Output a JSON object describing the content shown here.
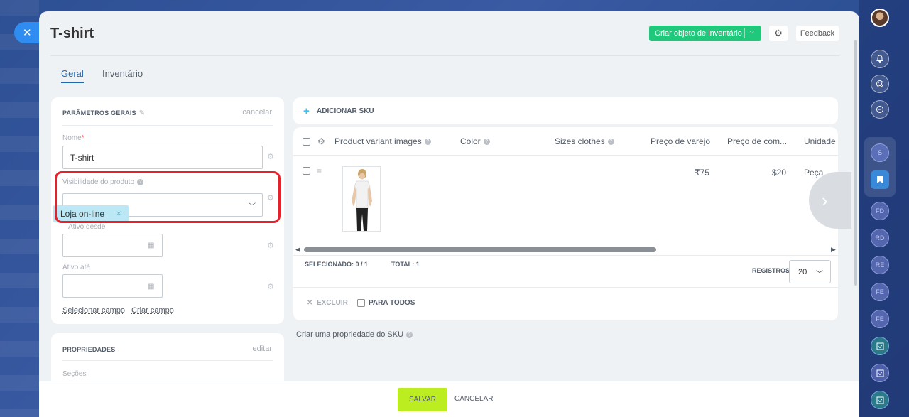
{
  "header": {
    "title": "T-shirt",
    "create_btn": "Criar objeto de inventário",
    "feedback": "Feedback"
  },
  "tabs": [
    {
      "label": "Geral",
      "active": true
    },
    {
      "label": "Inventário",
      "active": false
    }
  ],
  "general_params": {
    "title": "PARÂMETROS GERAIS",
    "cancel": "cancelar",
    "name_label": "Nome",
    "name_required": "*",
    "name_value": "T-shirt",
    "visibility_label": "Visibilidade do produto",
    "visibility_tag": "Loja on-line",
    "active_from_label": "Ativo desde",
    "active_to_label": "Ativo até",
    "select_field": "Selecionar campo",
    "create_field": "Criar campo"
  },
  "properties": {
    "title": "PROPRIEDADES",
    "edit": "editar",
    "sections_label": "Seções"
  },
  "sku": {
    "add_label": "ADICIONAR SKU",
    "columns": [
      "Product variant images",
      "Color",
      "Sizes clothes",
      "Preço de varejo",
      "Preço de com...",
      "Unidade d"
    ],
    "rows": [
      {
        "retail_price": "₹75",
        "purchase_price": "$20",
        "unit": "Peça"
      }
    ],
    "selected_label": "SELECIONADO:",
    "selected_value": "0 / 1",
    "total_label": "TOTAL:",
    "total_value": "1",
    "records_label": "REGISTROS:",
    "records_value": "20",
    "delete_label": "EXCLUIR",
    "for_all_label": "PARA TODOS",
    "create_property": "Criar uma propriedade do SKU"
  },
  "footer": {
    "save": "SALVAR",
    "cancel": "CANCELAR"
  },
  "rail": {
    "s": "S",
    "fd": "FD",
    "rd": "RD",
    "re": "RE",
    "fe": "FE",
    "fe2": "FE"
  },
  "colors": {
    "accent_blue": "#2066b0",
    "green_button": "#1fc87a",
    "save_button": "#bbed21",
    "highlight_box": "#e8202a",
    "tag_bg": "#bce8f5"
  }
}
